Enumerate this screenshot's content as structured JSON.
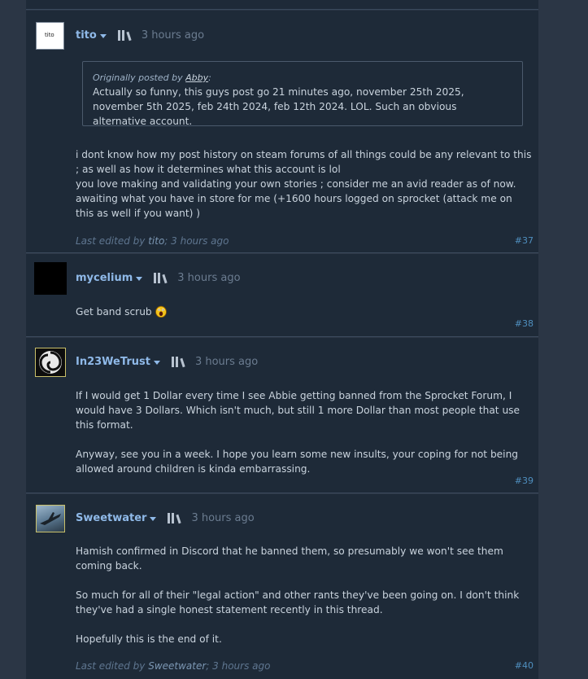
{
  "posts": [
    {
      "author": "tito",
      "avatar_text": "tito",
      "time": "3 hours ago",
      "quote": {
        "prefix": "Originally posted by ",
        "quoted_author": "Abby",
        "suffix": ":",
        "text": "Actually so funny, this guys post go 21 minutes ago, november 25th 2025, november 5th 2025, feb 24th 2024, feb 12th 2024. LOL. Such an obvious alternative account."
      },
      "lines": [
        "i dont know how my post history on steam forums of all things could be any relevant to this ; as well as how it determines what this account is lol",
        "you love making and validating your own stories ; consider me an avid reader as of now.",
        "awaiting what you have in store for me (+1600 hours logged on sprocket (attack me on this as well if you want) )"
      ],
      "edited_prefix": "Last edited by ",
      "edited_by": "tito",
      "edited_suffix": "; 3 hours ago",
      "number": "#37"
    },
    {
      "author": "mycelium",
      "time": "3 hours ago",
      "text": "Get band scrub",
      "number": "#38"
    },
    {
      "author": "In23WeTrust",
      "time": "3 hours ago",
      "para1": "If I would get 1 Dollar every time I see Abbie getting banned from the Sprocket Forum, I would have 3 Dollars. Which isn't much, but still 1 more Dollar than most people that use this format.",
      "para2": "Anyway, see you in a week. I hope you learn some new insults, your coping for not being allowed around children is kinda embarrassing.",
      "number": "#39"
    },
    {
      "author": "Sweetwater",
      "time": "3 hours ago",
      "para1": "Hamish confirmed in Discord that he banned them, so presumably we won't see them coming back.",
      "para2": "So much for all of their \"legal action\" and other rants they've been going on. I don't think they've had a single honest statement recently in this thread.",
      "para3": "Hopefully this is the end of it.",
      "edited_prefix": "Last edited by ",
      "edited_by": "Sweetwater",
      "edited_suffix": "; 3 hours ago",
      "number": "#40"
    }
  ],
  "colors": {
    "page_bg": "#2b3645",
    "post_bg": "#1e2a38",
    "author": "#8fb9e8",
    "body": "#c9d3dd",
    "post_number": "#4f8fbf"
  },
  "icons": [
    "dropdown-caret-icon",
    "books-icon",
    "screaming-face-emoji"
  ]
}
